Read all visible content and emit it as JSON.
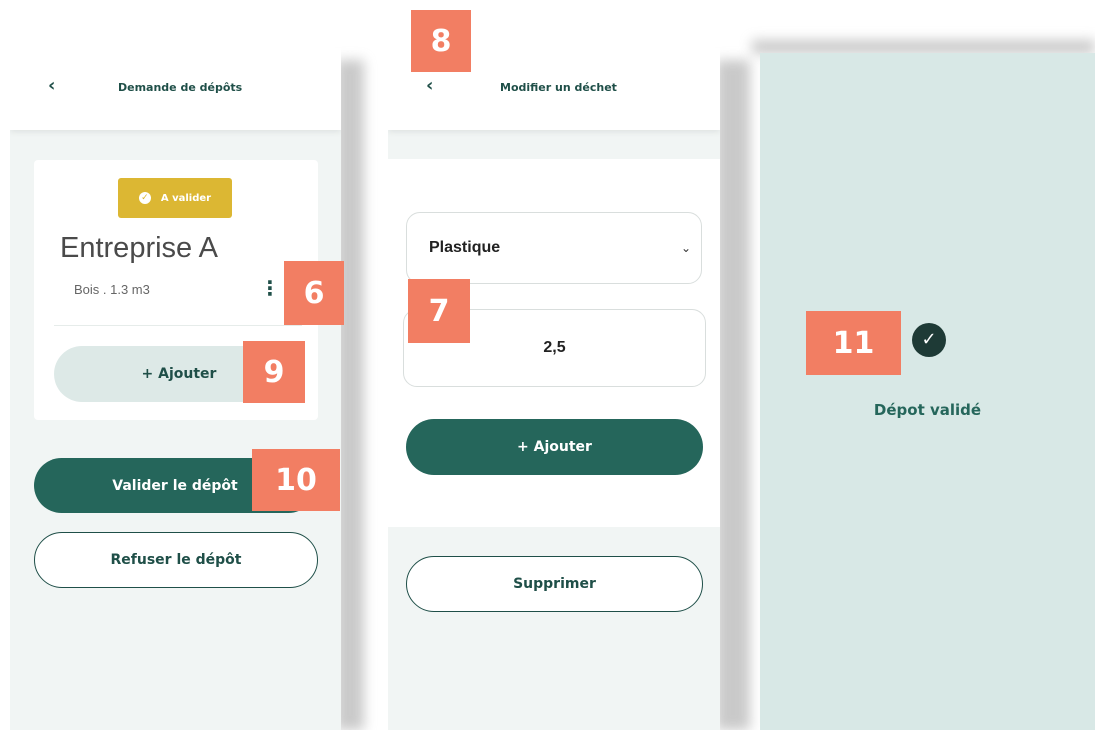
{
  "screen1": {
    "back_icon": "chevron-left-icon",
    "title": "Demande de dépôts",
    "badge": {
      "icon": "check-circle-icon",
      "label": "A valider",
      "color": "#dcb733"
    },
    "company": "Entreprise A",
    "item_line": "Bois . 1.3 m3",
    "more_icon": "kebab-menu-icon",
    "add_button": "+ Ajouter",
    "validate_button": "Valider le dépôt",
    "refuse_button": "Refuser le dépôt"
  },
  "screen2": {
    "back_icon": "chevron-left-icon",
    "title": "Modifier un déchet",
    "select_value": "Plastique",
    "quantity_value": "2,5",
    "add_button": "+ Ajouter",
    "delete_button": "Supprimer"
  },
  "screen3": {
    "icon": "check-circle-icon",
    "message": "Dépot validé"
  },
  "annotations": [
    "6",
    "7",
    "8",
    "9",
    "10",
    "11"
  ],
  "colors": {
    "primary": "#25665b",
    "annotation": "#f27e63",
    "success_bg": "#d8e8e6"
  }
}
